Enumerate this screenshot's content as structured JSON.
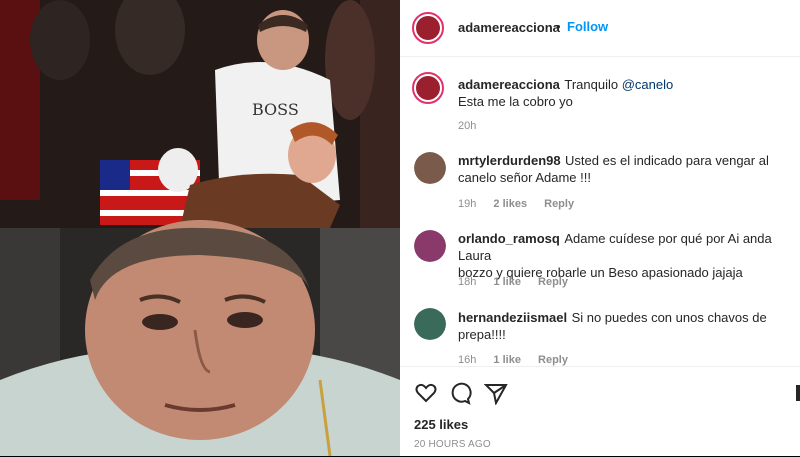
{
  "post": {
    "username": "adamereacciona",
    "separator": "•",
    "follow_label": "Follow"
  },
  "caption": {
    "username": "adamereacciona",
    "text_prefix": "Tranquilo ",
    "mention": "@canelo",
    "text_line2": "Esta me la cobro yo",
    "time": "20h"
  },
  "comments": [
    {
      "username": "mrtylerdurden98",
      "text": "Usted es el indicado para vengar al",
      "text2": "canelo señor Adame !!!",
      "time": "19h",
      "likes": "2 likes",
      "reply": "Reply",
      "avatar_color": "#7a5a4a"
    },
    {
      "username": "orlando_ramosq",
      "text": "Adame cuídese por qué por Ai anda Laura",
      "text2": "bozzo y quiere robarle un Beso apasionado jajaja",
      "time": "18h",
      "likes": "1 like",
      "reply": "Reply",
      "avatar_color": "#8a3a6a"
    },
    {
      "username": "hernandeziismael",
      "text": "Si no puedes con unos chavos de",
      "text2": "prepa!!!!",
      "time": "16h",
      "likes": "1 like",
      "reply": "Reply",
      "avatar_color": "#3a6a5a"
    }
  ],
  "footer": {
    "likes": "225 likes",
    "time_ago": "20 HOURS AGO"
  },
  "icons": [
    "heart-icon",
    "comment-icon",
    "share-icon",
    "more-icon"
  ],
  "colors": {
    "follow": "#0095f6",
    "ring": "#e1306c",
    "meta": "#8e8e8e"
  },
  "media": {
    "top_shirt_text": "BOSS"
  }
}
